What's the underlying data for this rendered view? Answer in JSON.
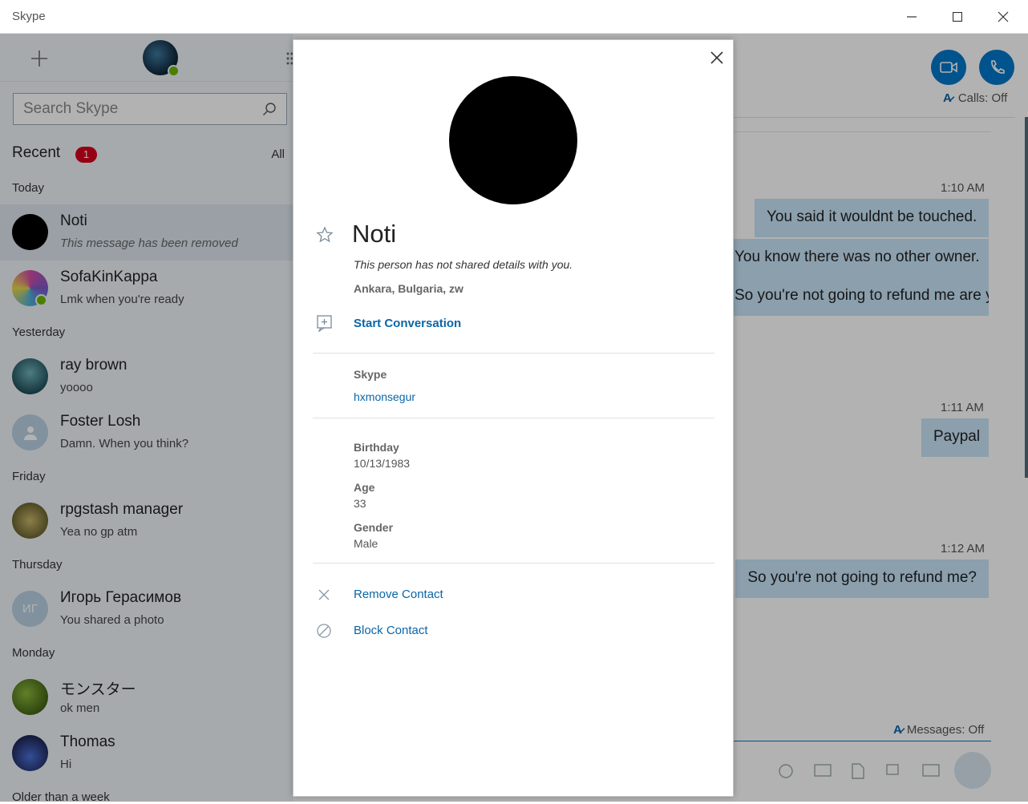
{
  "window": {
    "title": "Skype"
  },
  "sidebar": {
    "search_placeholder": "Search Skype",
    "recent_label": "Recent",
    "unread_count": "1",
    "filter_label": "All",
    "sections": {
      "today": "Today",
      "yesterday": "Yesterday",
      "friday": "Friday",
      "thursday": "Thursday",
      "monday": "Monday",
      "older": "Older than a week"
    },
    "contacts": [
      {
        "name": "Noti",
        "message": "This message has been removed"
      },
      {
        "name": "SofaKinKappa",
        "message": "Lmk when you're ready"
      },
      {
        "name": "ray brown",
        "message": "yoooo"
      },
      {
        "name": "Foster Losh",
        "message": "Damn. When you think?"
      },
      {
        "name": "rpgstash manager",
        "message": "Yea no gp atm"
      },
      {
        "name": "Игорь  Герасимов",
        "message": "You shared a photo",
        "initials": "ИГ"
      },
      {
        "name": "モンスター",
        "message": "ok men"
      },
      {
        "name": "Thomas",
        "message": "Hi"
      }
    ]
  },
  "conversation": {
    "calls_label": "Calls: Off",
    "messages_label": "Messages: Off",
    "groups": [
      {
        "time": "1:10 AM",
        "messages": [
          "You said it wouldnt be touched.",
          "You know there was no other owner.",
          "So you're not going to refund me are you?"
        ]
      },
      {
        "time": "1:11 AM",
        "messages": [
          "Paypal"
        ]
      },
      {
        "time": "1:12 AM",
        "messages": [
          "So you're not going to refund me?"
        ]
      }
    ]
  },
  "profile": {
    "name": "Noti",
    "note": "This person has not shared details with you.",
    "location": "Ankara, Bulgaria, zw",
    "start_conversation": "Start Conversation",
    "skype_label": "Skype",
    "skype_id": "hxmonsegur",
    "birthday_label": "Birthday",
    "birthday": "10/13/1983",
    "age_label": "Age",
    "age": "33",
    "gender_label": "Gender",
    "gender": "Male",
    "remove_contact": "Remove Contact",
    "block_contact": "Block Contact"
  },
  "colors": {
    "accent": "#0078ca",
    "link": "#0a66a8",
    "bubble": "#c8e4f8",
    "badge": "#d6001c",
    "online": "#6bb700"
  }
}
